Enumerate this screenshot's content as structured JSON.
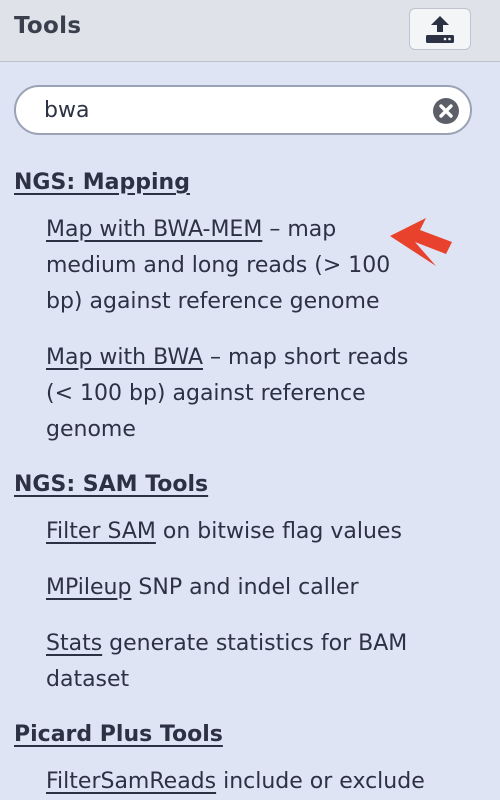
{
  "header": {
    "title": "Tools",
    "upload_icon": "upload-icon"
  },
  "search": {
    "value": "bwa",
    "clear_icon": "clear-icon"
  },
  "sections": [
    {
      "title": "NGS: Mapping",
      "tools": [
        {
          "link": "Map with BWA-MEM",
          "desc_line1": " – map",
          "desc_line2": "medium and long reads (> 100",
          "desc_line3": "bp) against reference genome"
        },
        {
          "link": "Map with BWA",
          "desc_line1": " – map short reads",
          "desc_line2": "(< 100 bp) against reference",
          "desc_line3": "genome"
        }
      ]
    },
    {
      "title": "NGS: SAM Tools",
      "tools": [
        {
          "link": "Filter SAM",
          "desc_line1": " on bitwise flag values"
        },
        {
          "link": "MPileup",
          "desc_line1": " SNP and indel caller"
        },
        {
          "link": "Stats",
          "desc_line1": " generate statistics for BAM",
          "desc_line2": "dataset"
        }
      ]
    },
    {
      "title": "Picard Plus Tools",
      "tools": [
        {
          "link": "FilterSamReads",
          "desc_line1": " include or exclude"
        }
      ]
    }
  ],
  "annotation": {
    "arrow_color": "#e8412c"
  },
  "colors": {
    "panel_bg": "#dfe4f5",
    "header_bg": "#dfe2e8",
    "text": "#2c3143"
  }
}
